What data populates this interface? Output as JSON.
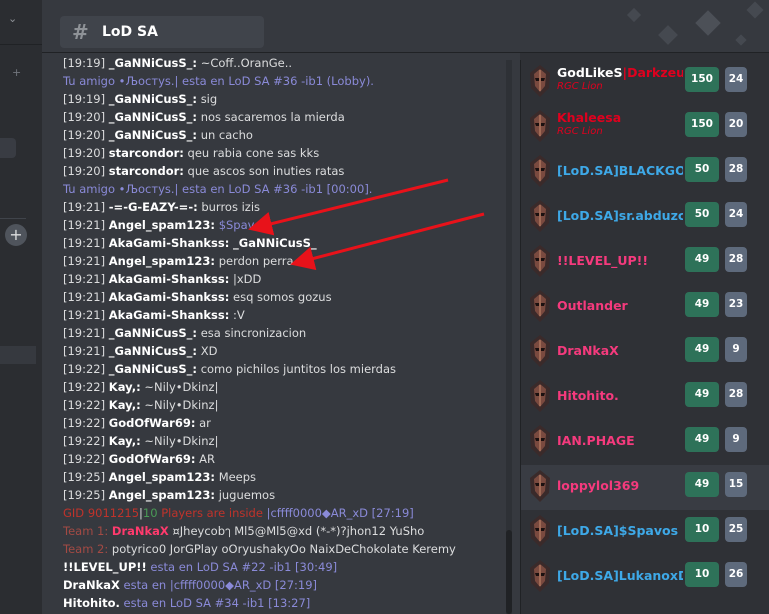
{
  "channel": {
    "name": "LoD SA"
  },
  "chat": {
    "lines": [
      {
        "ts": "[19:19]",
        "nick": "_GaNNiCusS_:",
        "msg": "~Coff..OranGe..",
        "kind": "normal"
      },
      {
        "text": "Tu amigo •Љοстуs.| esta en LoD SA #36 -ib1 (Lobby).",
        "kind": "sys"
      },
      {
        "ts": "[19:19]",
        "nick": "_GaNNiCusS_:",
        "msg": "sig",
        "kind": "normal"
      },
      {
        "ts": "[19:20]",
        "nick": "_GaNNiCusS_:",
        "msg": "nos sacaremos la mierda",
        "kind": "normal"
      },
      {
        "ts": "[19:20]",
        "nick": "_GaNNiCusS_:",
        "msg": "un cacho",
        "kind": "normal"
      },
      {
        "ts": "[19:20]",
        "nick": "starcondor:",
        "msg": "qeu rabia cone sas kks",
        "kind": "normal"
      },
      {
        "ts": "[19:20]",
        "nick": "starcondor:",
        "msg": "que ascos son inuties ratas",
        "kind": "normal"
      },
      {
        "text": "Tu amigo •Љοстуs.| esta en LoD SA #36 -ib1 [00:00].",
        "kind": "sys"
      },
      {
        "ts": "[19:21]",
        "nick": "-=-G-EAZY-=-:",
        "msg": "burros izis",
        "kind": "normal"
      },
      {
        "ts": "[19:21]",
        "nick": "Angel_spam123:",
        "msg": "$Spavos",
        "kind": "normal",
        "msgclass": "sys"
      },
      {
        "ts": "[19:21]",
        "nick": "AkaGami-Shankss:",
        "msg": "_GaNNiCusS_",
        "kind": "normal",
        "msgclass": "nick"
      },
      {
        "ts": "[19:21]",
        "nick": "Angel_spam123:",
        "msg": "perdon perra :)",
        "kind": "normal"
      },
      {
        "ts": "[19:21]",
        "nick": "AkaGami-Shankss:",
        "msg": "|xDD",
        "kind": "normal"
      },
      {
        "ts": "[19:21]",
        "nick": "AkaGami-Shankss:",
        "msg": "esq somos gozus",
        "kind": "normal"
      },
      {
        "ts": "[19:21]",
        "nick": "AkaGami-Shankss:",
        "msg": ":V",
        "kind": "normal"
      },
      {
        "ts": "[19:21]",
        "nick": "_GaNNiCusS_:",
        "msg": "esa sincronizacion",
        "kind": "normal"
      },
      {
        "ts": "[19:21]",
        "nick": "_GaNNiCusS_:",
        "msg": "XD",
        "kind": "normal"
      },
      {
        "ts": "[19:22]",
        "nick": "_GaNNiCusS_:",
        "msg": "como pichilos juntitos los mierdas",
        "kind": "normal"
      },
      {
        "ts": "[19:22]",
        "nick": "Kay,:",
        "msg": "~Nily•Dkinz|",
        "kind": "normal"
      },
      {
        "ts": "[19:22]",
        "nick": "Kay,:",
        "msg": "~Nily•Dkinz|",
        "kind": "normal"
      },
      {
        "ts": "[19:22]",
        "nick": "GodOfWar69:",
        "msg": "ar",
        "kind": "normal"
      },
      {
        "ts": "[19:22]",
        "nick": "Kay,:",
        "msg": "~Nily•Dkinz|",
        "kind": "normal"
      },
      {
        "ts": "[19:22]",
        "nick": "GodOfWar69:",
        "msg": "AR",
        "kind": "normal"
      },
      {
        "ts": "[19:25]",
        "nick": "Angel_spam123:",
        "msg": "Meeps",
        "kind": "normal"
      },
      {
        "ts": "[19:25]",
        "nick": "Angel_spam123:",
        "msg": "juguemos",
        "kind": "normal"
      }
    ],
    "gid": {
      "label": "GID 9011215",
      "sep": "|",
      "count": "10",
      "players": "Players are inside",
      "tail": "|cffff0000◆AR_xD [27:19]"
    },
    "team1": {
      "label": "Team 1:",
      "lead": "DraNkaX",
      "members": "¤Jheycobๅ   Ml5@Ml5@xd   (*-*)?jhon12   YuSho"
    },
    "team2": {
      "label": "Team 2:",
      "members": "potyrico0   JorGPlay   oOryushakyOo   NaixDeChokolate   Keremy"
    },
    "tail": [
      {
        "name": "!!LEVEL_UP!!",
        "text": "esta en LoD SA #22 -ib1 [30:49]"
      },
      {
        "name": "DraNkaX",
        "text": "esta en  |cffff0000◆AR_xD [27:19]"
      },
      {
        "name": "Hitohito.",
        "text": "esta en LoD SA #34 -ib1 [13:27]"
      }
    ]
  },
  "players": [
    {
      "name": "GodLikeS",
      "name_color": "#ffffff",
      "extra": "|Darkzeus|",
      "extra_color": "#e0001e",
      "sub": "RGC Lion",
      "lvl": "150",
      "n": "24"
    },
    {
      "name": "Khaleesa",
      "name_color": "#e0001e",
      "sub": "RGC Lion",
      "lvl": "150",
      "n": "20"
    },
    {
      "name": "[LoD.SA]BLACKGOKU",
      "name_color": "#3ea9e8",
      "lvl": "50",
      "n": "28"
    },
    {
      "name": "[LoD.SA]sr.abduzcan",
      "name_color": "#3ea9e8",
      "lvl": "50",
      "n": "24"
    },
    {
      "name": "!!LEVEL_UP!!",
      "name_color": "#f53a7d",
      "lvl": "49",
      "n": "28"
    },
    {
      "name": "Outlander",
      "name_color": "#f53a7d",
      "lvl": "49",
      "n": "23"
    },
    {
      "name": "DraNkaX",
      "name_color": "#f53a7d",
      "lvl": "49",
      "n": "9"
    },
    {
      "name": "Hitohito.",
      "name_color": "#f53a7d",
      "lvl": "49",
      "n": "28"
    },
    {
      "name": "IAN.PHAGE",
      "name_color": "#f53a7d",
      "lvl": "49",
      "n": "9"
    },
    {
      "name": "loppylol369",
      "name_color": "#f53a7d",
      "lvl": "49",
      "n": "15",
      "selected": true
    },
    {
      "name": "[LoD.SA]$Spavos",
      "name_color": "#3ea9e8",
      "lvl": "10",
      "n": "25"
    },
    {
      "name": "[LoD.SA]LukanoxD",
      "name_color": "#3ea9e8",
      "lvl": "10",
      "n": "26"
    }
  ]
}
